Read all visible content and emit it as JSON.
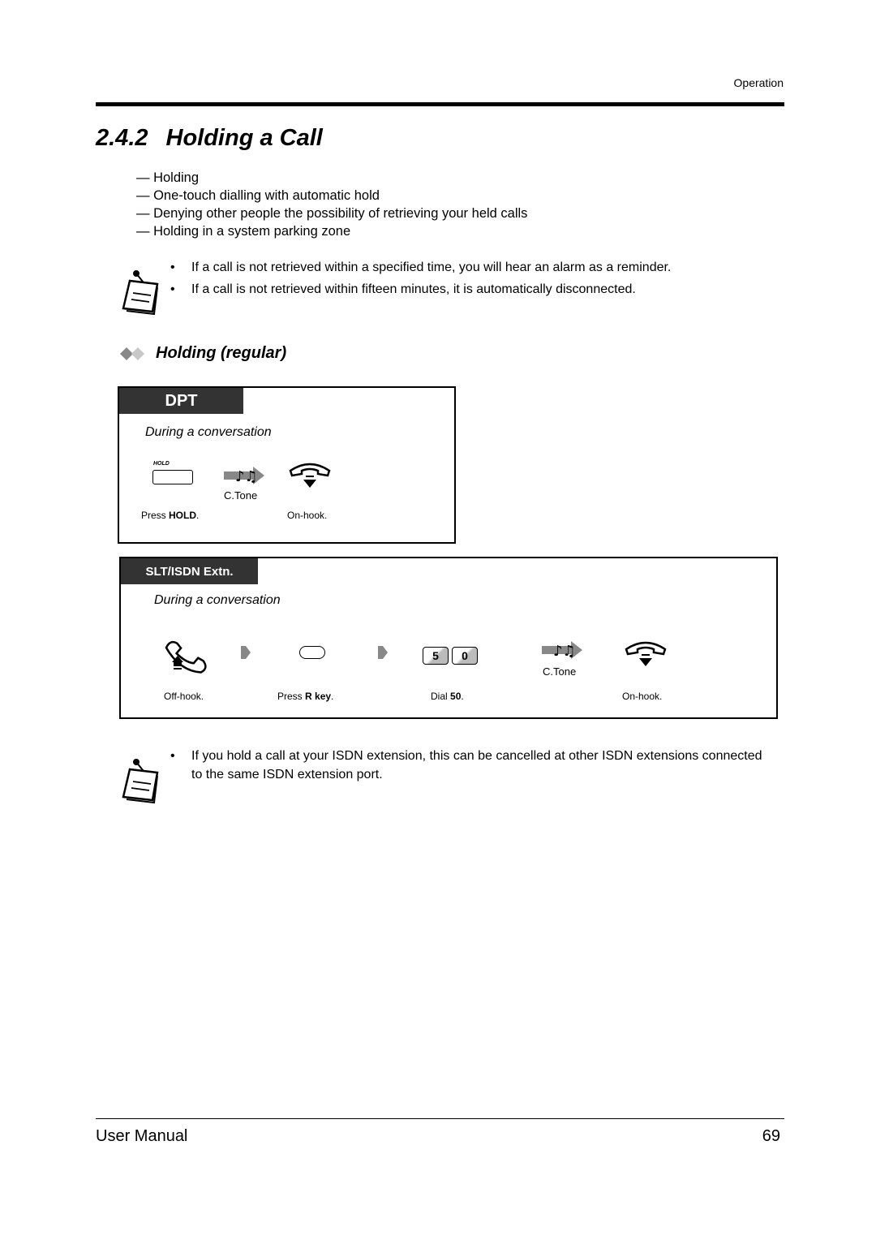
{
  "header": {
    "section": "Operation"
  },
  "title": {
    "number": "2.4.2",
    "text": "Holding a Call"
  },
  "topics": [
    "— Holding",
    "— One-touch dialling with automatic hold",
    "— Denying other people the possibility of retrieving your held calls",
    "— Holding in a system parking zone"
  ],
  "note1": {
    "icon": "note-pad-icon",
    "bullets": [
      "If a call is not retrieved within a specified time, you will hear an alarm as a reminder.",
      "If a call is not retrieved within fifteen minutes, it is automatically disconnected."
    ]
  },
  "subheading": {
    "icon": "double-diamond-icon",
    "text": "Holding (regular)"
  },
  "dpt": {
    "tab": "DPT",
    "context": "During a conversation",
    "hold_key_label": "HOLD",
    "tone_label": "C.Tone",
    "step1_prefix": "Press ",
    "step1_bold": "HOLD",
    "step1_suffix": ".",
    "step2": "On-hook."
  },
  "slt": {
    "tab": "SLT/ISDN Extn.",
    "context": "During a conversation",
    "step1": "Off-hook.",
    "step2_prefix": "Press ",
    "step2_bold": "R key",
    "step2_suffix": ".",
    "keys": [
      "5",
      "0"
    ],
    "step3_prefix": "Dial ",
    "step3_bold": "50",
    "step3_suffix": ".",
    "tone_label": "C.Tone",
    "step4": "On-hook."
  },
  "note2": {
    "icon": "note-pad-icon",
    "bullets": [
      "If you hold a call at your ISDN extension, this can be cancelled at other ISDN extensions connected to the same ISDN extension port."
    ]
  },
  "footer": {
    "left": "User Manual",
    "page": "69"
  }
}
